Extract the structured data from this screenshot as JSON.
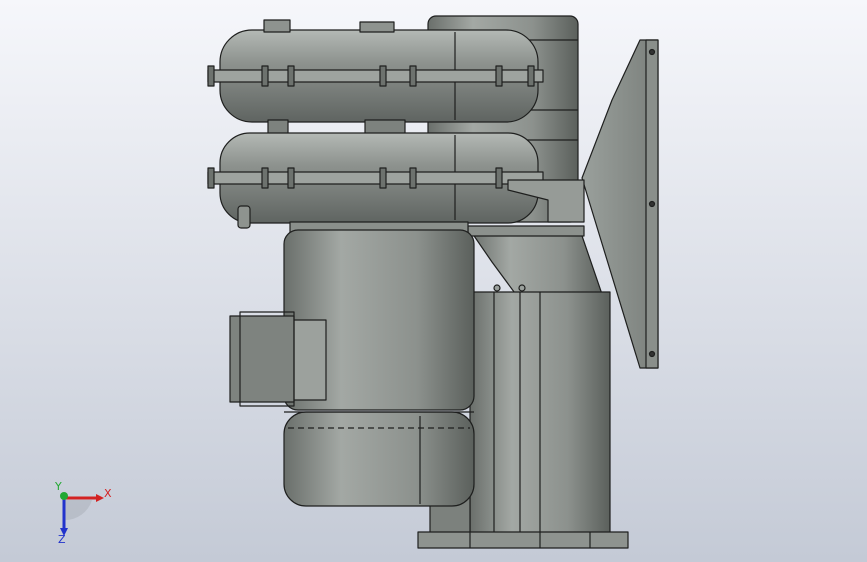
{
  "viewport": {
    "background_top": "#f6f7fb",
    "background_bottom": "#c4cad6"
  },
  "model": {
    "body_color": "#8f9490",
    "edge_color": "#1e1f1e"
  },
  "triad": {
    "x_label": "X",
    "y_label": "Y",
    "z_label": "Z",
    "x_color": "#d32222",
    "y_color": "#22a833",
    "z_color": "#2233cc"
  },
  "icons": [
    "axis-triad-icon"
  ]
}
